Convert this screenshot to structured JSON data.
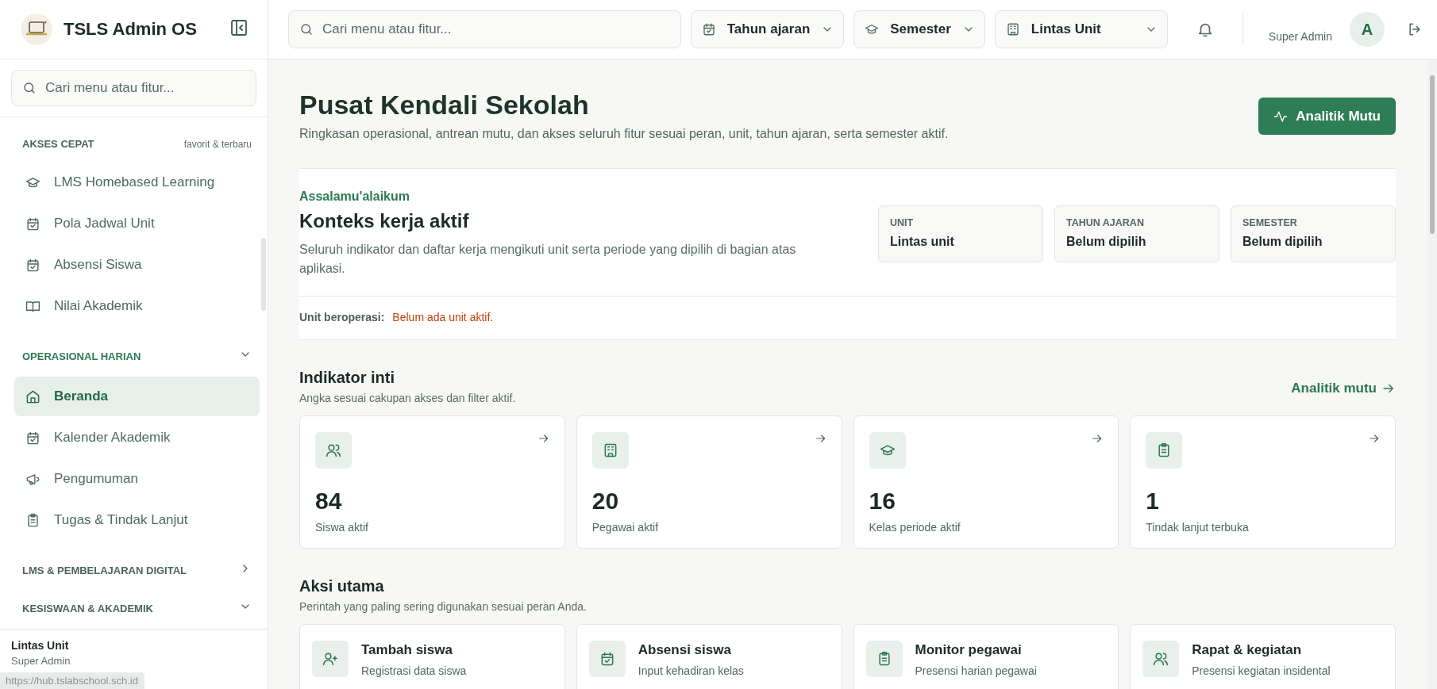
{
  "sidebar": {
    "brand": "TSLS Admin OS",
    "search": {
      "placeholder": "Cari menu atau fitur..."
    },
    "sections": [
      {
        "kind": "quick",
        "title": "AKSES CEPAT",
        "note": "favorit & terbaru",
        "items": [
          {
            "label": "LMS Homebased Learning",
            "selected": false
          },
          {
            "label": "Pola Jadwal Unit",
            "selected": false
          },
          {
            "label": "Absensi Siswa",
            "selected": false
          },
          {
            "label": "Nilai Akademik",
            "selected": false
          }
        ]
      },
      {
        "kind": "group",
        "title": "OPERASIONAL HARIAN",
        "expanded": true,
        "items": [
          {
            "label": "Beranda",
            "selected": true
          },
          {
            "label": "Kalender Akademik",
            "selected": false
          },
          {
            "label": "Pengumuman",
            "selected": false
          },
          {
            "label": "Tugas & Tindak Lanjut",
            "selected": false
          }
        ]
      },
      {
        "kind": "group",
        "title": "LMS & PEMBELAJARAN DIGITAL",
        "expanded": false
      },
      {
        "kind": "group",
        "title": "KESISWAAN & AKADEMIK",
        "expanded": true
      }
    ],
    "footer": {
      "unit": "Lintas Unit",
      "role": "Super Admin"
    }
  },
  "topbar": {
    "search": {
      "placeholder": "Cari menu atau fitur..."
    },
    "selectors": [
      {
        "label": "Tahun ajaran"
      },
      {
        "label": "Semester"
      },
      {
        "label": "Lintas Unit"
      }
    ],
    "user": {
      "role": "Super Admin",
      "initial": "A"
    }
  },
  "header": {
    "title": "Pusat Kendali Sekolah",
    "subtitle": "Ringkasan operasional, antrean mutu, dan akses seluruh fitur sesuai peran, unit, tahun ajaran, serta semester aktif.",
    "button": "Analitik Mutu"
  },
  "context": {
    "greeting": "Assalamu'alaikum",
    "title": "Konteks kerja aktif",
    "description": "Seluruh indikator dan daftar kerja mengikuti unit serta periode yang dipilih di bagian atas aplikasi.",
    "chips": [
      {
        "label": "UNIT",
        "value": "Lintas unit"
      },
      {
        "label": "TAHUN AJARAN",
        "value": "Belum dipilih"
      },
      {
        "label": "SEMESTER",
        "value": "Belum dipilih"
      }
    ],
    "operating_label": "Unit beroperasi:",
    "operating_value": "Belum ada unit aktif."
  },
  "indicators": {
    "title": "Indikator inti",
    "subtitle": "Angka sesuai cakupan akses dan filter aktif.",
    "link": "Analitik mutu",
    "cards": [
      {
        "value": "84",
        "label": "Siswa aktif"
      },
      {
        "value": "20",
        "label": "Pegawai aktif"
      },
      {
        "value": "16",
        "label": "Kelas periode aktif"
      },
      {
        "value": "1",
        "label": "Tindak lanjut terbuka"
      }
    ]
  },
  "actions": {
    "title": "Aksi utama",
    "subtitle": "Perintah yang paling sering digunakan sesuai peran Anda.",
    "cards": [
      {
        "title": "Tambah siswa",
        "subtitle": "Registrasi data siswa"
      },
      {
        "title": "Absensi siswa",
        "subtitle": "Input kehadiran kelas"
      },
      {
        "title": "Monitor pegawai",
        "subtitle": "Presensi harian pegawai"
      },
      {
        "title": "Rapat & kegiatan",
        "subtitle": "Presensi kegiatan insidental"
      }
    ]
  },
  "status_url": "https://hub.tslabschool.sch.id"
}
